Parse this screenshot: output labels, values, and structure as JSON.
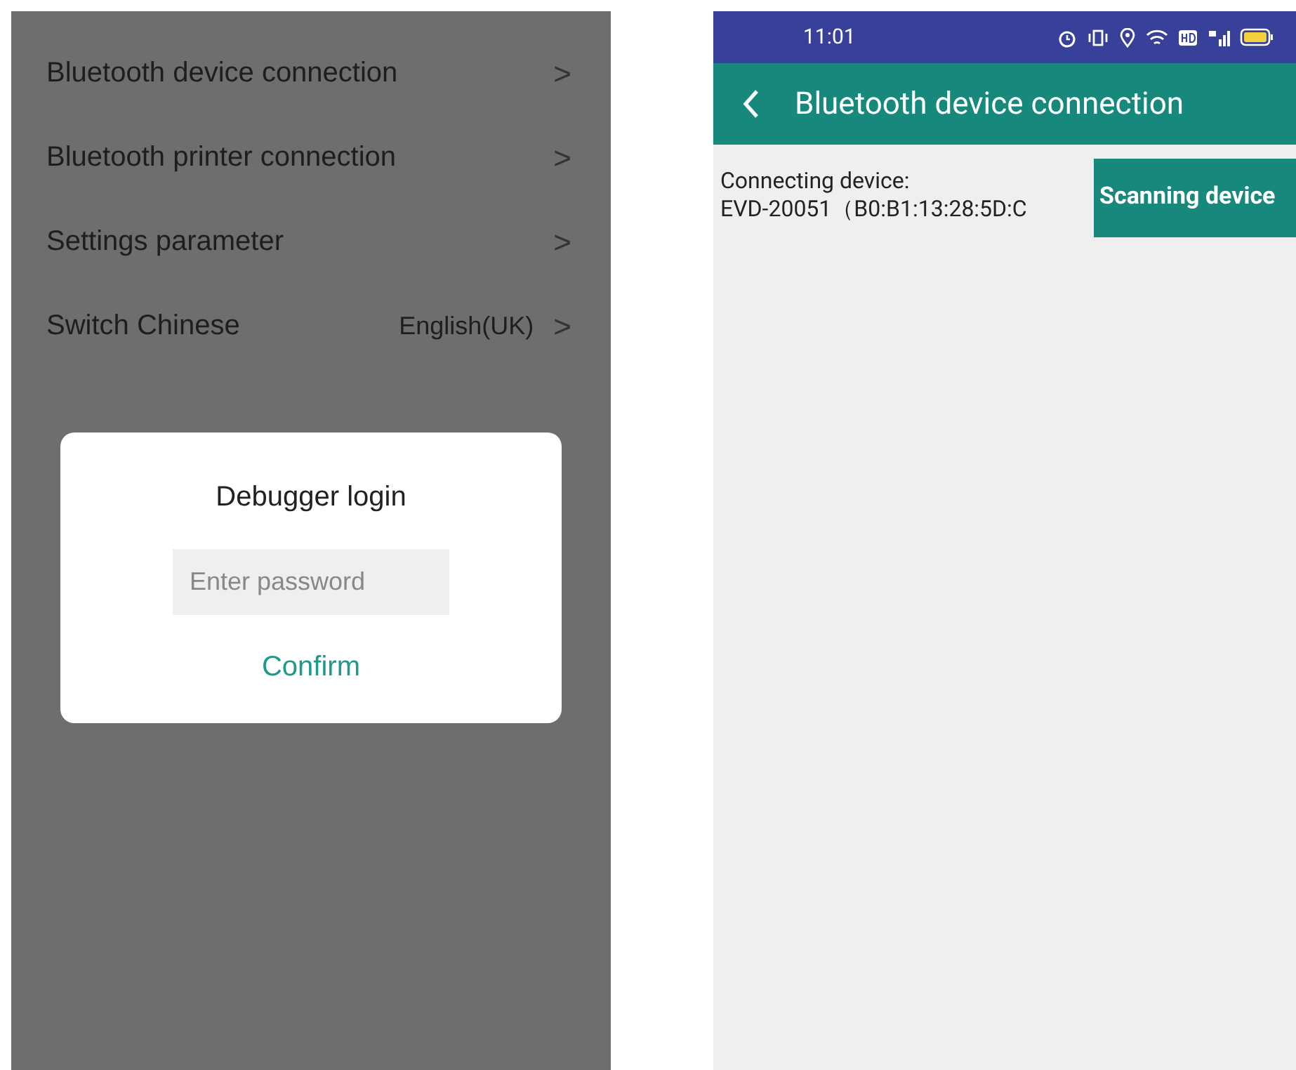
{
  "left_screen": {
    "menu_items": [
      {
        "label": "Bluetooth device connection",
        "chevron": ">"
      },
      {
        "label": "Bluetooth printer connection",
        "chevron": ">"
      },
      {
        "label": "Settings parameter",
        "chevron": ">"
      },
      {
        "label": "Switch Chinese",
        "value": "English(UK)",
        "chevron": ">"
      }
    ],
    "dialog": {
      "title": "Debugger login",
      "password_field": {
        "placeholder": "Enter password"
      },
      "confirm_button": "Confirm"
    }
  },
  "right_screen": {
    "status_bar": {
      "time": "11:01"
    },
    "app_bar": {
      "title": "Bluetooth device connection"
    },
    "connecting_label": "Connecting device:",
    "device": "EVD-20051（B0:B1:13:28:5D:C",
    "scan_button": "Scanning device"
  }
}
